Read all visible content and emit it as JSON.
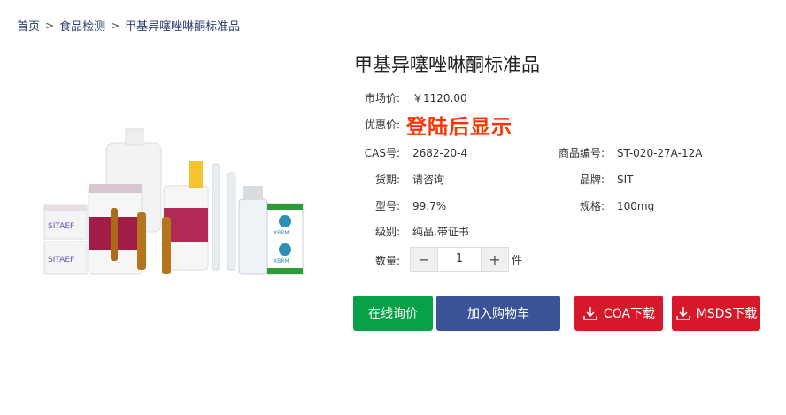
{
  "breadcrumb": {
    "home": "首页",
    "category": "食品检测",
    "current": "甲基异噻唑啉酮标准品",
    "separator": ">"
  },
  "product": {
    "title": "甲基异噻唑啉酮标准品",
    "market_price_label": "市场价:",
    "market_price": "￥1120.00",
    "discount_label": "优惠价:",
    "discount_value": "登陆后显示",
    "cas_label": "CAS号:",
    "cas": "2682-20-4",
    "code_label": "商品编号:",
    "code": "ST-020-27A-12A",
    "period_label": "货期:",
    "period": "请咨询",
    "brand_label": "品牌:",
    "brand": "SIT",
    "model_label": "型号:",
    "model": "99.7%",
    "spec_label": "规格:",
    "spec": "100mg",
    "grade_label": "级别:",
    "grade": "纯品,带证书",
    "qty_label": "数量:",
    "qty": "1",
    "unit": "件",
    "minus": "−",
    "plus": "+"
  },
  "image": {
    "box_label_1": "SITAEF",
    "box_label_2": "SITAEF",
    "box_brand_1": "XBRM",
    "box_brand_2": "XBRM"
  },
  "actions": {
    "inquiry": "在线询价",
    "add_cart": "加入购物车",
    "coa": "COA下载",
    "msds": "MSDS下载"
  },
  "colors": {
    "green": "#08a046",
    "blue": "#3a5297",
    "red": "#d7182a",
    "promo": "#ff3300"
  }
}
